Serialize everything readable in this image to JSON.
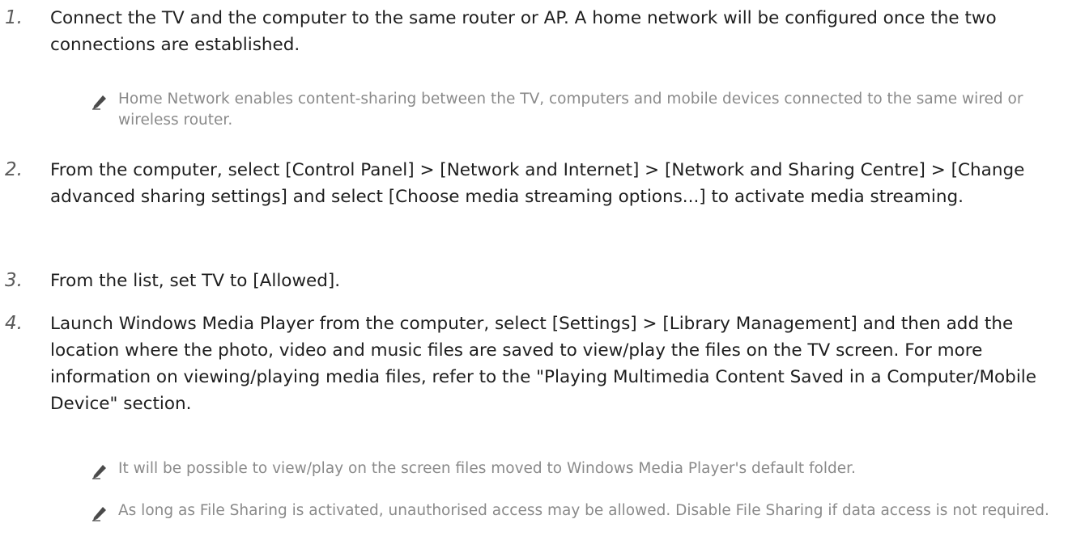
{
  "steps": [
    {
      "number": "1.",
      "text": "Connect the TV and the computer to the same router or AP. A home network will be configured once the two connections are established."
    },
    {
      "number": "2.",
      "text": "From the computer, select [Control Panel] > [Network and Internet] > [Network and Sharing Centre] > [Change advanced sharing settings] and select [Choose media streaming options...] to activate media streaming."
    },
    {
      "number": "3.",
      "text": "From the list, set TV to [Allowed]."
    },
    {
      "number": "4.",
      "text": "Launch Windows Media Player from the computer, select [Settings] > [Library Management] and then add the location where the photo, video and music files are saved to view/play the files on the TV screen. For more information on viewing/playing media files, refer to the \"Playing Multimedia Content Saved in a Computer/Mobile Device\" section."
    }
  ],
  "notes": [
    {
      "icon": "pencil-icon",
      "text": "Home Network enables content-sharing between the TV, computers and mobile devices connected to the same wired or wireless router."
    },
    {
      "icon": "pencil-icon",
      "text": "It will be possible to view/play on the screen files moved to Windows Media Player's default folder."
    },
    {
      "icon": "pencil-icon",
      "text": "As long as File Sharing is activated, unauthorised access may be allowed. Disable File Sharing if data access is not required."
    }
  ]
}
